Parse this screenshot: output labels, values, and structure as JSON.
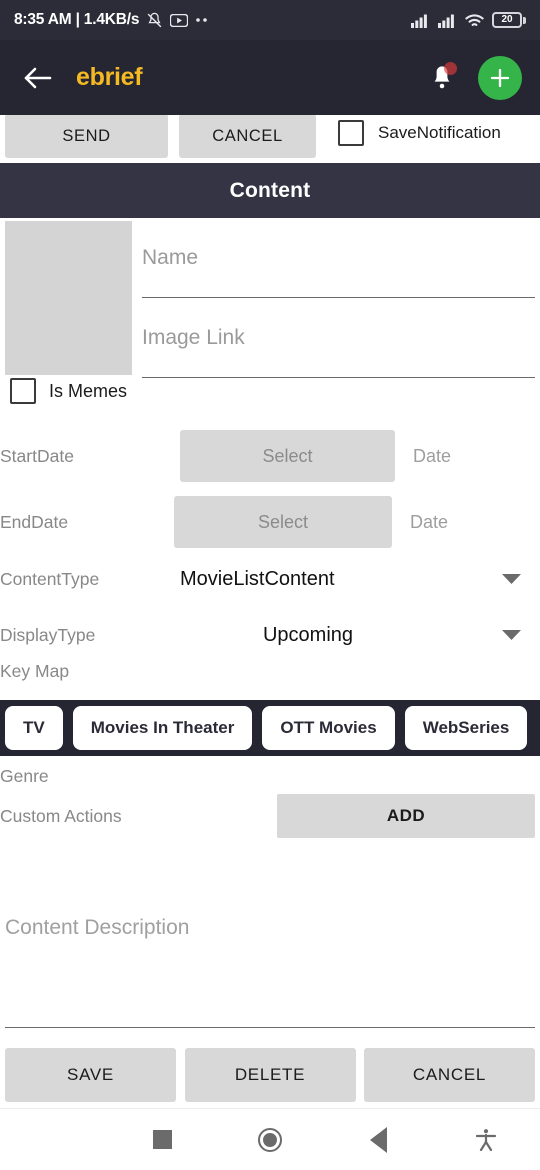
{
  "status_bar": {
    "clock": "8:35 AM | 1.4KB/s",
    "mute_icon": "bell-muted-icon",
    "youtube_icon": "youtube-icon",
    "more_icon": "more-dots-icon",
    "signal1_icon": "signal-bars-icon",
    "signal2_icon": "signal-bars-icon",
    "wifi_icon": "wifi-icon",
    "battery_level": "20"
  },
  "app_bar": {
    "back_icon": "back-arrow-icon",
    "title": "ebrief",
    "notification_icon": "bell-icon",
    "add_icon": "plus-icon",
    "title_color": "#F5B921",
    "fab_color": "#35B44A",
    "background_color": "#262633"
  },
  "action_row": {
    "send_label": "SEND",
    "cancel_label": "CANCEL",
    "save_notification_label": "SaveNotification",
    "save_notification_checked": false
  },
  "content_header": {
    "title": "Content",
    "background_color": "#343445"
  },
  "form": {
    "thumbnail_placeholder": "image-thumbnail-placeholder",
    "name_placeholder": "Name",
    "name_value": "",
    "image_link_placeholder": "Image Link",
    "image_link_value": "",
    "is_memes_label": "Is Memes",
    "is_memes_checked": false,
    "start_date": {
      "label": "StartDate",
      "button_label": "Select",
      "suffix": "Date"
    },
    "end_date": {
      "label": "EndDate",
      "button_label": "Select",
      "suffix": "Date"
    },
    "content_type": {
      "label": "ContentType",
      "value": "MovieListContent",
      "caret_icon": "chevron-down-icon"
    },
    "display_type": {
      "label": "DisplayType",
      "value": "Upcoming",
      "caret_icon": "chevron-down-icon"
    },
    "key_map_label": "Key Map",
    "chips": [
      {
        "label": "TV"
      },
      {
        "label": "Movies In Theater"
      },
      {
        "label": "OTT Movies"
      },
      {
        "label": "WebSeries"
      }
    ],
    "genre_label": "Genre",
    "custom_actions_label": "Custom Actions",
    "add_label": "ADD",
    "description_placeholder": "Content Description",
    "description_value": ""
  },
  "bottom_bar": {
    "save_label": "SAVE",
    "delete_label": "DELETE",
    "cancel_label": "CANCEL"
  },
  "nav_bar": {
    "recents_icon": "square-recents-icon",
    "home_icon": "circle-home-icon",
    "back_icon": "triangle-back-icon",
    "accessibility_icon": "accessibility-icon"
  }
}
